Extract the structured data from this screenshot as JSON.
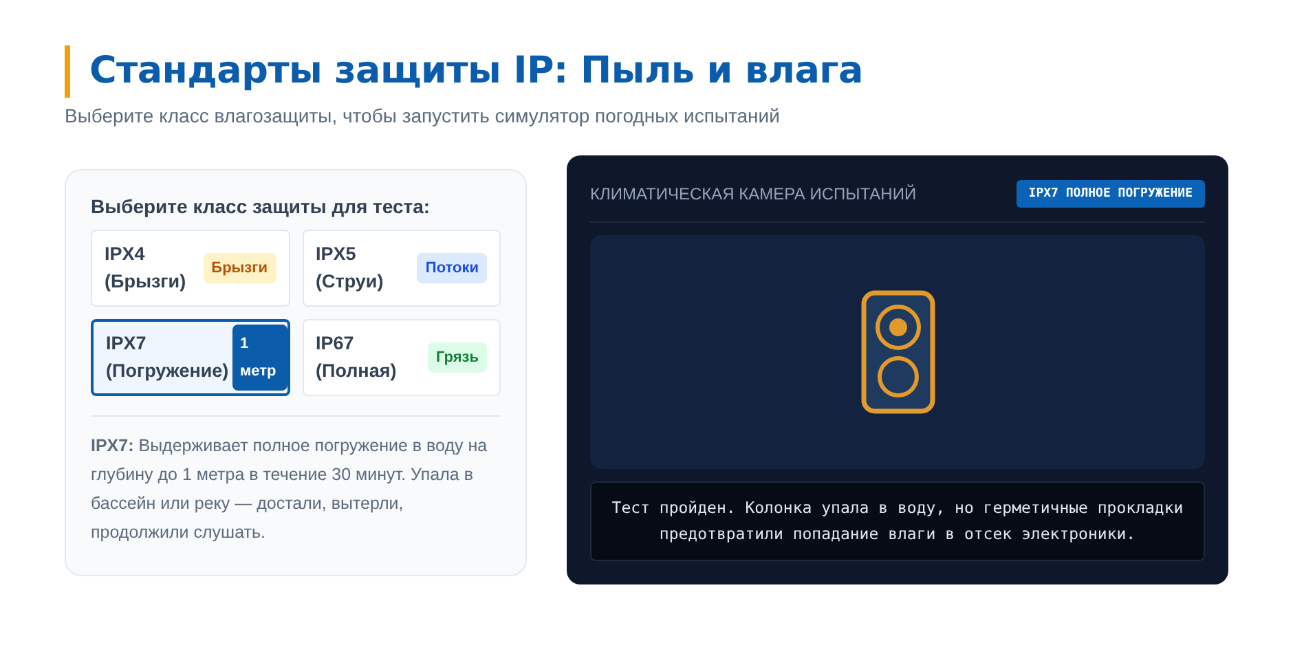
{
  "header": {
    "title": "Стандарты защиты IP: Пыль и влага",
    "subtitle": "Выберите класс влагозащиты, чтобы запустить симулятор погодных испытаний"
  },
  "selector": {
    "heading": "Выберите класс защиты для теста:",
    "options": [
      {
        "name": "IPX4",
        "note": "(Брызги)",
        "badge": "Брызги",
        "kind": "yellow",
        "selected": false
      },
      {
        "name": "IPX5",
        "note": "(Струи)",
        "badge": "Потоки",
        "kind": "blue",
        "selected": false
      },
      {
        "name": "IPX7",
        "note": "(Погружение)",
        "badge": "1 метр",
        "kind": "blue",
        "selected": true
      },
      {
        "name": "IP67",
        "note": "(Полная)",
        "badge": "Грязь",
        "kind": "green",
        "selected": false
      }
    ],
    "description": "**IPX7:** Выдерживает полное погружение в воду на глубину до 1 метра в течение 30 минут. Упала в бассейн или реку — достали, вытерли, продолжили слушать."
  },
  "chamber": {
    "title": "КЛИМАТИЧЕСКАЯ КАМЕРА ИСПЫТАНИЙ",
    "badge": "IPX7 ПОЛНОЕ ПОГРУЖЕНИЕ",
    "result": "Тест пройден. Колонка упала в воду, но герметичные прокладки предотвратили попадание влаги в отсек электроники."
  }
}
